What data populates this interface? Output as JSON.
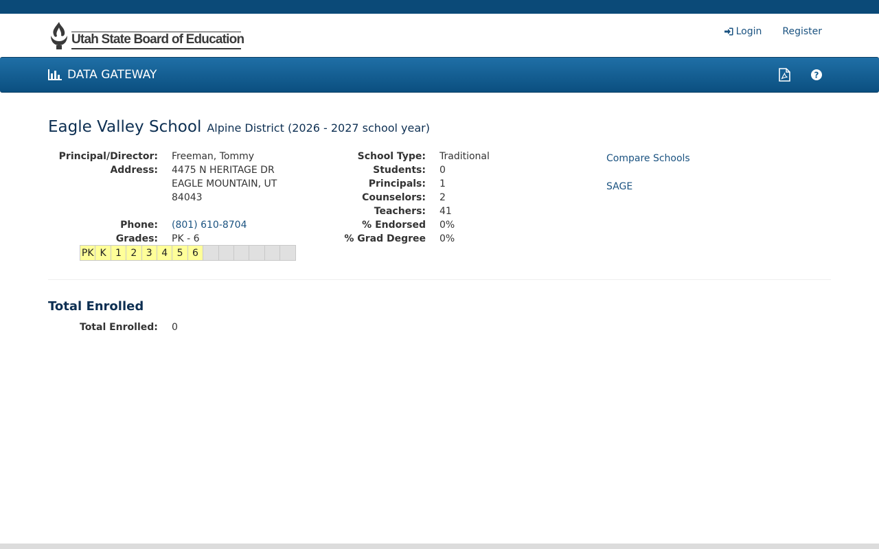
{
  "header": {
    "logo_text": "Utah State Board of Education",
    "login_label": "Login",
    "register_label": "Register"
  },
  "navbar": {
    "brand": "DATA GATEWAY",
    "icons": [
      "pdf-icon",
      "help-icon"
    ]
  },
  "school": {
    "name": "Eagle Valley School",
    "subtitle": "Alpine District (2026 - 2027 school year)",
    "left": [
      {
        "label": "Principal/Director:",
        "value": "Freeman, Tommy"
      },
      {
        "label": "Address:",
        "value": "4475 N HERITAGE DR"
      },
      {
        "label": "",
        "value": "EAGLE MOUNTAIN, UT"
      },
      {
        "label": "",
        "value": "84043"
      },
      {
        "label": "Phone:",
        "value": "(801) 610-8704"
      },
      {
        "label": "Grades:",
        "value": "PK - 6"
      }
    ],
    "right": [
      {
        "label": "School Type:",
        "value": "Traditional"
      },
      {
        "label": "Students:",
        "value": "0"
      },
      {
        "label": "Principals:",
        "value": "1"
      },
      {
        "label": "Counselors:",
        "value": "2"
      },
      {
        "label": "Teachers:",
        "value": "41"
      },
      {
        "label": "% Endorsed",
        "value": "0%"
      },
      {
        "label": "% Grad Degree",
        "value": "0%"
      }
    ],
    "grade_cells": [
      "PK",
      "K",
      "1",
      "2",
      "3",
      "4",
      "5",
      "6",
      "",
      "",
      "",
      "",
      "",
      ""
    ],
    "links": [
      "Compare Schools",
      "SAGE"
    ]
  },
  "enrollment": {
    "section_title": "Total Enrolled",
    "label": "Total Enrolled:",
    "value": "0"
  },
  "colors": {
    "topbar": "#0b4a78",
    "navbar": "#1a6499",
    "link": "#1a5280",
    "grade_active": "#ffff99",
    "grade_inactive": "#e0e0e0"
  }
}
